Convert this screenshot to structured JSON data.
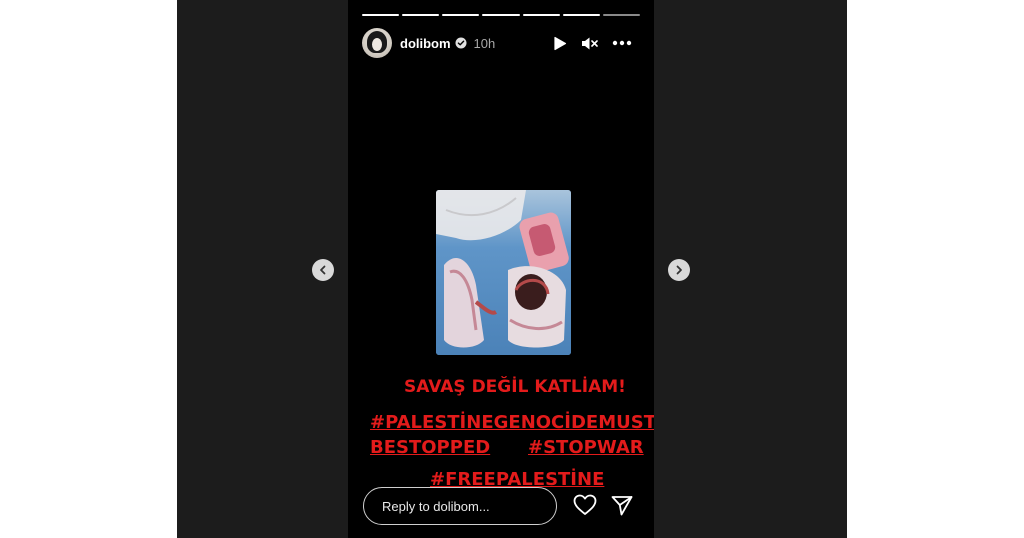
{
  "story": {
    "username": "dolibom",
    "time": "10h",
    "segments_total": 7,
    "segments_viewed": 6,
    "caption_line1": "SAVAŞ DEĞİL KATLİAM!",
    "hashtag_line1": "#PALESTİNEGENOCİDEMUST",
    "hashtag_line2a": "BESTOPPED",
    "hashtag_line2b": "#STOPWAR",
    "hashtag_line3": "#FREEPALESTİNE",
    "caption_color": "#e31b1b"
  },
  "reply": {
    "placeholder": "Reply to dolibom..."
  },
  "icons": {
    "play": "play-icon",
    "mute": "muted-speaker-icon",
    "more": "more-options-icon",
    "verified": "verified-badge-icon",
    "like": "heart-icon",
    "share": "send-icon",
    "prev": "chevron-left-icon",
    "next": "chevron-right-icon"
  }
}
